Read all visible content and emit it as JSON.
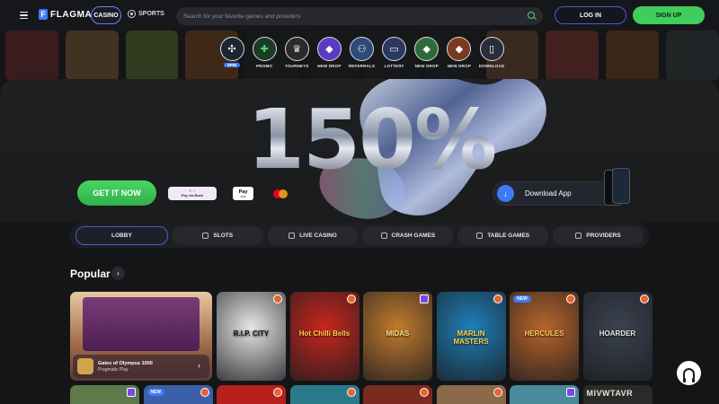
{
  "header": {
    "logo_mark": "F",
    "logo_text": "FLAGMAN",
    "casino_label": "CASINO",
    "sports_label": "SPORTS",
    "search_placeholder": "Search for your favorite games and providers",
    "login_label": "LOG IN",
    "signup_label": "SIGN UP"
  },
  "quicknav": [
    {
      "label": "SPIN",
      "icon": "wheel-icon",
      "color": "#ffffff",
      "bg": "#1c2531",
      "badge": true
    },
    {
      "label": "PROMO",
      "icon": "gift-icon",
      "color": "#4fd36d",
      "bg": "#1d3a25",
      "badge": false
    },
    {
      "label": "TOURNEYS",
      "icon": "trophy-icon",
      "color": "#e7e7e7",
      "bg": "#2b2b2b",
      "badge": false
    },
    {
      "label": "NEW DROP",
      "icon": "game-thumb-icon",
      "color": "#ffffff",
      "bg": "#5a3cc4",
      "badge": false
    },
    {
      "label": "REFERRALS",
      "icon": "referral-icon",
      "color": "#ffffff",
      "bg": "#2d4a7a",
      "badge": false
    },
    {
      "label": "LOTTERY",
      "icon": "ticket-icon",
      "color": "#ffffff",
      "bg": "#2a3760",
      "badge": false
    },
    {
      "label": "NEW DROP",
      "icon": "game-thumb-icon",
      "color": "#ffffff",
      "bg": "#2f6a3a",
      "badge": false
    },
    {
      "label": "NEW DROP",
      "icon": "game-thumb-icon",
      "color": "#ffffff",
      "bg": "#7a3a1f",
      "badge": false
    },
    {
      "label": "DOWNLOAD",
      "icon": "phone-icon",
      "color": "#ffffff",
      "bg": "#2a2d3a",
      "badge": false
    }
  ],
  "hero": {
    "title": "150%",
    "cta_label": "GET IT NOW",
    "pay_via_bank": "Pay via Bank",
    "apple_pay": "Pay",
    "apple_pay_sub": "visa",
    "download_label": "Download App"
  },
  "categories": [
    {
      "label": "LOBBY",
      "active": true,
      "icon": "lobby-icon"
    },
    {
      "label": "SLOTS",
      "active": false,
      "icon": "slots-icon"
    },
    {
      "label": "LIVE CASINO",
      "active": false,
      "icon": "live-casino-icon"
    },
    {
      "label": "CRASH GAMES",
      "active": false,
      "icon": "crash-icon"
    },
    {
      "label": "TABLE GAMES",
      "active": false,
      "icon": "table-games-icon"
    },
    {
      "label": "PROVIDERS",
      "active": false,
      "icon": "providers-icon"
    }
  ],
  "popular": {
    "title": "Popular",
    "featured": {
      "name": "Gates of Olympus 1000",
      "provider": "Pragmatic Play"
    },
    "games": [
      {
        "name": "R.I.P. CITY",
        "bg": "#e6e6e6",
        "fg": "#1b1b1b",
        "badge": "orange",
        "new": false
      },
      {
        "name": "Hot Chilli Bells",
        "bg": "#c8261d",
        "fg": "#ffd34a",
        "badge": "orange",
        "new": false
      },
      {
        "name": "MIDAS",
        "bg": "#c27b2d",
        "fg": "#ffe08a",
        "badge": "purple",
        "new": false
      },
      {
        "name": "MARLIN MASTERS",
        "bg": "#1f7fb8",
        "fg": "#ffd34a",
        "badge": "orange",
        "new": false
      },
      {
        "name": "HERCULES",
        "bg": "#b8652a",
        "fg": "#ffcc55",
        "badge": "orange",
        "new": true
      },
      {
        "name": "HOARDER",
        "bg": "#3b4350",
        "fg": "#e8e8e8",
        "badge": "orange",
        "new": false
      }
    ],
    "row2": [
      {
        "bg": "#5c7a4a",
        "badge": "purple",
        "new": false
      },
      {
        "bg": "#3b5fa8",
        "badge": "orange",
        "new": true
      },
      {
        "bg": "#b8201d",
        "badge": "orange",
        "new": false
      },
      {
        "bg": "#2b7a8a",
        "badge": "orange",
        "new": false
      },
      {
        "bg": "#7a2a1f",
        "badge": "orange",
        "new": false
      },
      {
        "bg": "#8a6a4a",
        "badge": "orange",
        "new": false
      },
      {
        "bg": "#4a8a9a",
        "badge": "purple",
        "new": false
      },
      {
        "bg": "#2a2a2a",
        "badge": "",
        "new": false
      }
    ],
    "row2_last_title": "MIVWTAVR"
  },
  "colors": {
    "accent_green": "#3fcd5b",
    "accent_blue": "#3d7bf5",
    "accent_purple": "#4c5cd2"
  }
}
